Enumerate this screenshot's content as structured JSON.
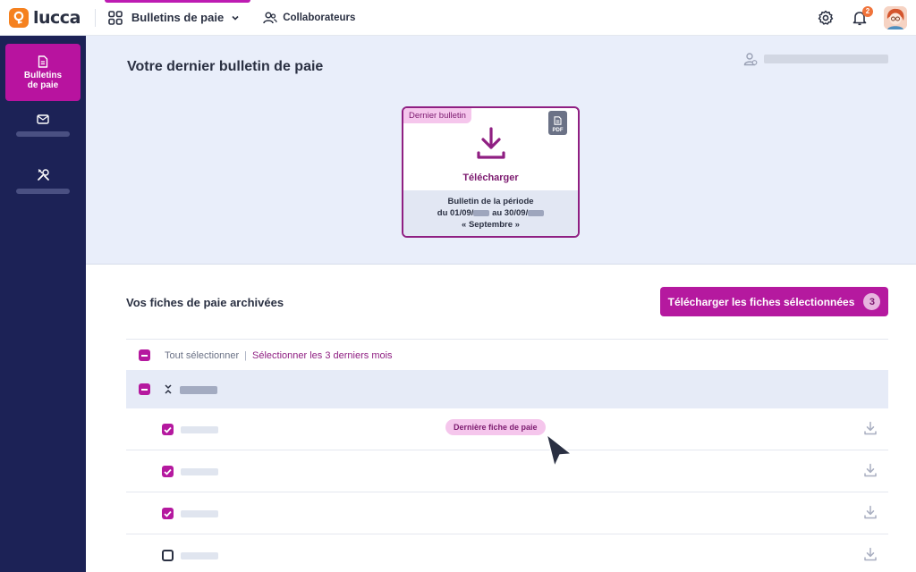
{
  "brand": {
    "name": "lucca",
    "color": "#f5811f"
  },
  "topbar": {
    "app_label": "Bulletins de paie",
    "collab_label": "Collaborateurs",
    "notif_count": "2"
  },
  "sidebar": {
    "items": [
      {
        "label": "Bulletins de paie",
        "icon": "document-icon",
        "active": true
      },
      {
        "label": "",
        "icon": "mail-icon",
        "active": false
      },
      {
        "label": "",
        "icon": "tools-icon",
        "active": false
      }
    ]
  },
  "upper": {
    "title": "Votre dernier bulletin de paie",
    "card": {
      "tag": "Dernier bulletin",
      "pdf_label": "PDF",
      "download_label": "Télécharger",
      "line1": "Bulletin de la période",
      "line2_a": "du 01/09/",
      "line2_b": " au 30/09/",
      "line3": "« Septembre »"
    }
  },
  "archive": {
    "title": "Vos fiches de paie archivées",
    "download_selected_label": "Télécharger les fiches sélectionnées",
    "selected_count": "3",
    "select_all": "Tout sélectionner",
    "separator": "|",
    "select_last3": "Sélectionner les 3 derniers mois",
    "latest_badge": "Dernière fiche de paie",
    "rows": [
      {
        "checked": true,
        "latest": true
      },
      {
        "checked": true,
        "latest": false
      },
      {
        "checked": true,
        "latest": false
      },
      {
        "checked": false,
        "latest": false
      }
    ]
  },
  "colors": {
    "accent": "#b5199f",
    "sidebar": "#1c2256",
    "upper_bg": "#e9eefa"
  }
}
